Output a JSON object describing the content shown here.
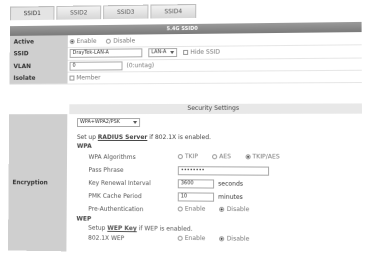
{
  "tabs": [
    "SSID1",
    "SSID2",
    "SSID3",
    "SSID4"
  ],
  "header": {
    "title": "5.4G SSID0"
  },
  "rows": {
    "active": {
      "label": "Active",
      "opt_enable": "Enable",
      "opt_disable": "Disable"
    },
    "ssid": {
      "label": "SSID",
      "value": "DrayTek-LAN-A",
      "select": "LAN-A",
      "hide_label": "Hide SSID"
    },
    "vlan": {
      "label": "VLAN",
      "value": "0",
      "hint": "(0:untag)"
    },
    "isolate": {
      "label": "Isolate",
      "member_label": "Member"
    }
  },
  "security": {
    "header": "Security Settings",
    "encryption_label": "Encryption",
    "mode": "WPA+WPA2/PSK",
    "setup_radius_prefix": "Set up",
    "setup_radius_link": "RADIUS Server",
    "setup_radius_suffix": "if 802.1X is enabled.",
    "wpa_title": "WPA",
    "wpa_algorithms": {
      "label": "WPA Algorithms",
      "opt1": "TKIP",
      "opt2": "AES",
      "opt3": "TKIP/AES"
    },
    "pass_phrase": {
      "label": "Pass Phrase",
      "value": "••••••••"
    },
    "key_renewal": {
      "label": "Key Renewal Interval",
      "value": "3600",
      "unit": "seconds"
    },
    "pmk_cache": {
      "label": "PMK Cache Period",
      "value": "10",
      "unit": "minutes"
    },
    "pre_auth": {
      "label": "Pre-Authentication",
      "opt_enable": "Enable",
      "opt_disable": "Disable"
    },
    "wep_title": "WEP",
    "setup_wep_prefix": "Setup",
    "setup_wep_link": "WEP Key",
    "setup_wep_suffix": "if WEP is enabled.",
    "wep_8021x": {
      "label": "802.1X WEP",
      "opt_enable": "Enable",
      "opt_disable": "Disable"
    }
  }
}
